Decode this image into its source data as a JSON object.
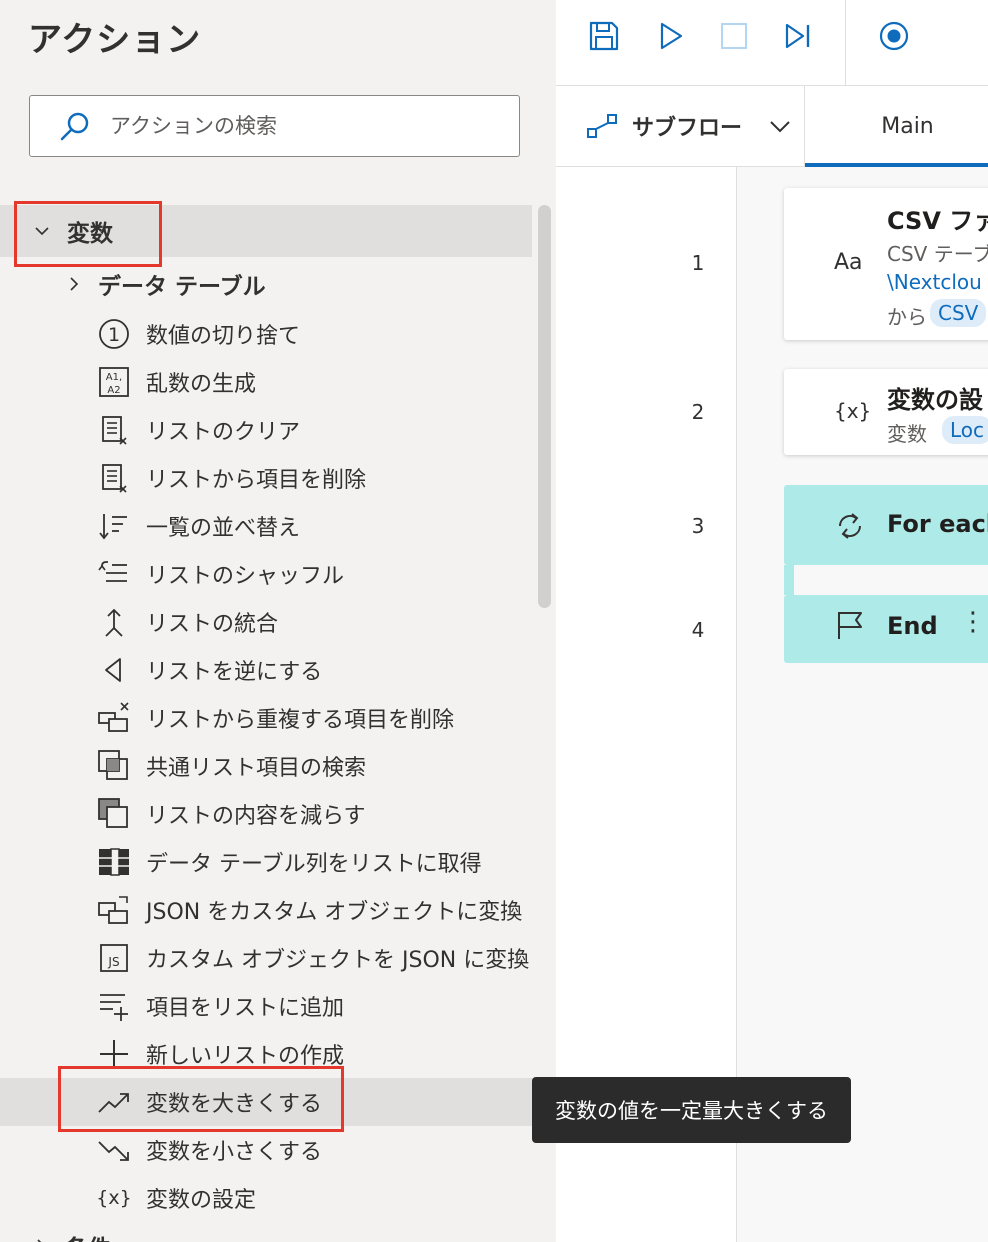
{
  "actions_pane": {
    "title": "アクション",
    "search_placeholder": "アクションの検索",
    "category": {
      "label": "変数",
      "expanded": true
    },
    "subcategory": {
      "label": "データ テーブル",
      "expanded": false
    },
    "items": [
      {
        "label": "数値の切り捨て",
        "icon": "circled-one-icon"
      },
      {
        "label": "乱数の生成",
        "icon": "random-number-icon"
      },
      {
        "label": "リストのクリア",
        "icon": "clear-list-icon"
      },
      {
        "label": "リストから項目を削除",
        "icon": "remove-list-item-icon"
      },
      {
        "label": "一覧の並べ替え",
        "icon": "sort-list-icon"
      },
      {
        "label": "リストのシャッフル",
        "icon": "shuffle-list-icon"
      },
      {
        "label": "リストの統合",
        "icon": "merge-lists-icon"
      },
      {
        "label": "リストを逆にする",
        "icon": "reverse-list-icon"
      },
      {
        "label": "リストから重複する項目を削除",
        "icon": "remove-duplicates-icon"
      },
      {
        "label": "共通リスト項目の検索",
        "icon": "common-items-icon"
      },
      {
        "label": "リストの内容を減らす",
        "icon": "subtract-lists-icon"
      },
      {
        "label": "データ テーブル列をリストに取得",
        "icon": "datatable-column-icon"
      },
      {
        "label": "JSON をカスタム オブジェクトに変換",
        "icon": "json-to-object-icon"
      },
      {
        "label": "カスタム オブジェクトを JSON に変換",
        "icon": "object-to-json-icon"
      },
      {
        "label": "項目をリストに追加",
        "icon": "add-to-list-icon"
      },
      {
        "label": "新しいリストの作成",
        "icon": "plus-icon"
      },
      {
        "label": "変数を大きくする",
        "icon": "trend-up-icon"
      },
      {
        "label": "変数を小さくする",
        "icon": "trend-down-icon"
      },
      {
        "label": "変数の設定",
        "icon": "variable-braces-icon",
        "glyph": "{x}"
      }
    ],
    "next_category_label": "条件"
  },
  "tooltip": "変数の値を一定量大きくする",
  "tabs": {
    "subflow_label": "サブフロー",
    "main_label": "Main"
  },
  "flow": {
    "steps": [
      {
        "number": "1",
        "icon_glyph": "Aa",
        "title": "CSV ファイ",
        "sub": "CSV テーブ",
        "link": "\\Nextclou",
        "prefix": "から",
        "chip": "CSV"
      },
      {
        "number": "2",
        "icon_glyph": "{x}",
        "title": "変数の設",
        "sub": "変数",
        "chip": "Loc"
      },
      {
        "number": "3",
        "title": "For each"
      },
      {
        "number": "4",
        "title": "End"
      }
    ]
  },
  "colors": {
    "accent": "#0f6cbd",
    "highlight_box": "#e3382b",
    "loop_block": "#aeeae7",
    "pane_bg": "#f3f2f1"
  }
}
